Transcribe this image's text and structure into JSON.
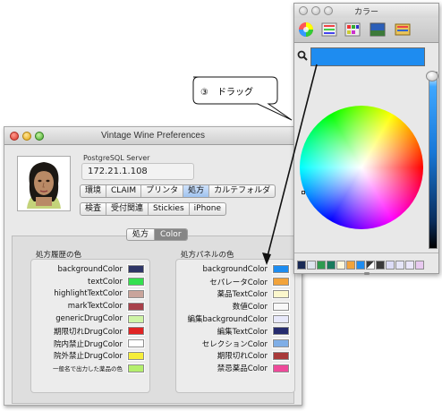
{
  "prefs": {
    "title": "Vintage Wine Preferences",
    "server_label": "PostgreSQL Server",
    "server_value": "172.21.1.108",
    "tabs_row1": [
      "環境",
      "CLAIM",
      "プリンタ",
      "処方",
      "カルテフォルダ"
    ],
    "tabs_row1_selected": 3,
    "tabs_row2": [
      "検査",
      "受付関連",
      "Stickies",
      "iPhone"
    ],
    "subtabs": [
      "処方",
      "Color"
    ],
    "left_section_title": "処方履歴の色",
    "right_section_title": "処方パネルの色",
    "left_rows": [
      {
        "label": "backgroundColor",
        "color": "#2e3566"
      },
      {
        "label": "textColor",
        "color": "#34e04f"
      },
      {
        "label": "highlightTextColor",
        "color": "#c9a49b"
      },
      {
        "label": "markTextColor",
        "color": "#a8404a"
      },
      {
        "label": "genericDrugColor",
        "color": "#cff5a6"
      },
      {
        "label": "期限切れDrugColor",
        "color": "#e02424"
      },
      {
        "label": "院内禁止DrugColor",
        "color": "#ffffff"
      },
      {
        "label": "院外禁止DrugColor",
        "color": "#f6ee3a"
      },
      {
        "label": "一般名で出力した薬品の色",
        "color": "#b4ef6d"
      }
    ],
    "right_rows": [
      {
        "label": "backgroundColor",
        "color": "#1d8cf0"
      },
      {
        "label": "セパレータColor",
        "color": "#f2a33a"
      },
      {
        "label": "薬品TextColor",
        "color": "#fbf7cc"
      },
      {
        "label": "数値Color",
        "color": "#f8f8f8"
      },
      {
        "label": "編集backgroundColor",
        "color": "#e8e9fb"
      },
      {
        "label": "編集TextColor",
        "color": "#262c6e"
      },
      {
        "label": "セレクションColor",
        "color": "#7faee6"
      },
      {
        "label": "期限切れColor",
        "color": "#a83a3a"
      },
      {
        "label": "禁忌薬品Color",
        "color": "#ee4a9a"
      }
    ]
  },
  "color_panel": {
    "title": "カラー",
    "selected_color": "#1e8cf0",
    "palette": [
      "#1a2a55",
      "#dde4ee",
      "#2f9a4f",
      "#1a7b5c",
      "#fff8dc",
      "#f2a33a",
      "#1e8cf0",
      "#3a3a3a",
      "#dcdcf6",
      "#e5e5f7",
      "#eae6fa",
      "#f0dcf0",
      "#e8c9f0"
    ]
  },
  "callout": {
    "text": "③　ドラッグ"
  }
}
